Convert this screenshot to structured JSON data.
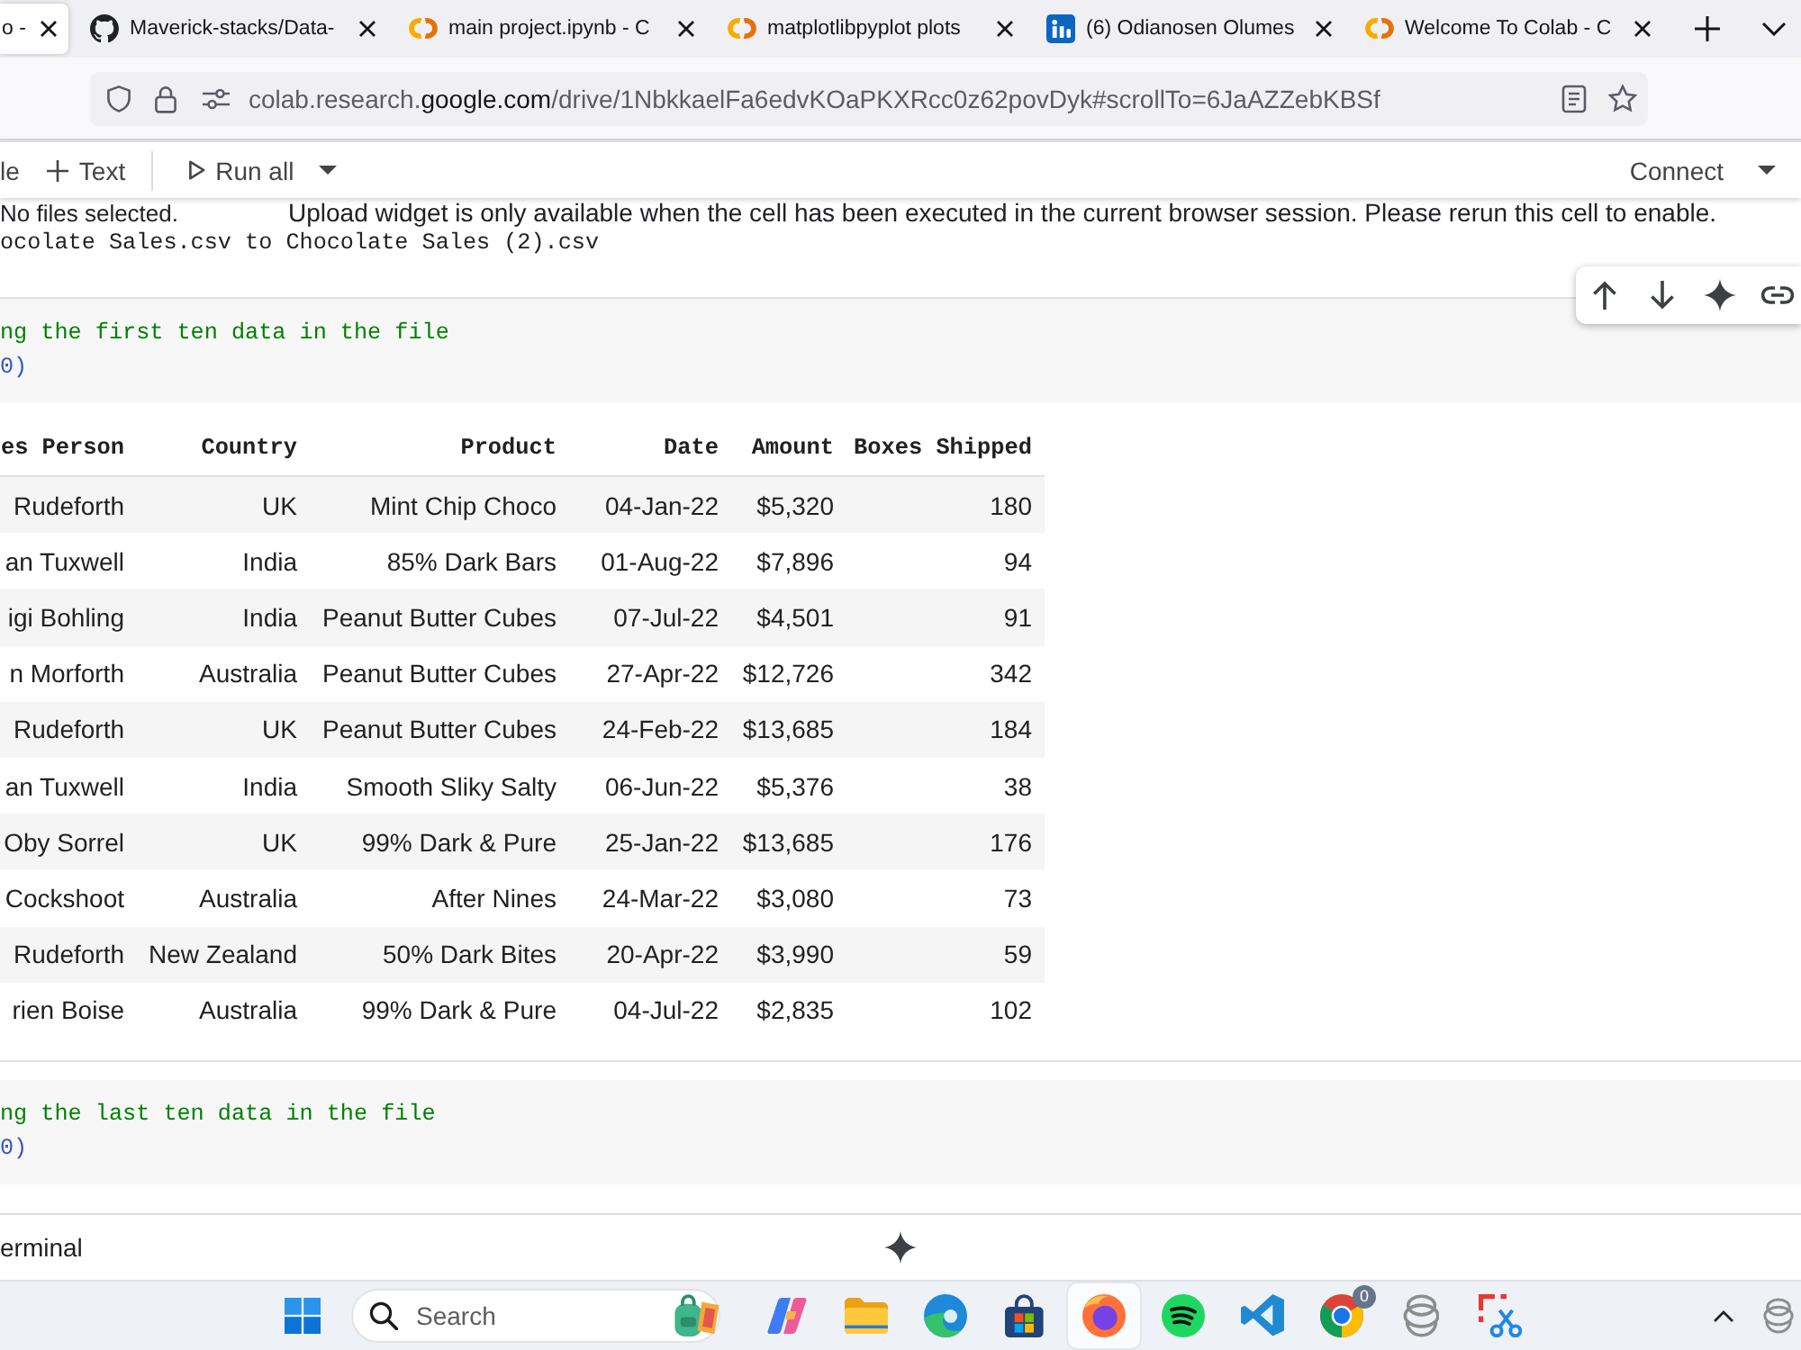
{
  "browser": {
    "tabs": [
      {
        "title": "o -",
        "kind": "none",
        "selected": true
      },
      {
        "title": "Maverick-stacks/Data-",
        "kind": "cat",
        "selected": false
      },
      {
        "title": "main project.ipynb - C",
        "kind": "rings",
        "selected": false
      },
      {
        "title": "matplotlibpyplot plots",
        "kind": "rings",
        "selected": false
      },
      {
        "title": "(6) Odianosen Olumes",
        "kind": "tile",
        "selected": false
      },
      {
        "title": "Welcome To Colab - C",
        "kind": "rings",
        "selected": false
      }
    ],
    "url": {
      "subdomain": "colab.research.",
      "domain": "google.com",
      "path": "/drive/1NbkkaelFa6edvKOaPKXRcc0z62povDyk#scrollTo=6JaAZZebKBSf"
    }
  },
  "notebook_toolbar": {
    "insert_buttons": [
      {
        "label": "le",
        "plus": false
      },
      {
        "label": "Text",
        "plus": true
      }
    ],
    "run_button": "Run all",
    "connect_button": "Connect"
  },
  "upload_output": {
    "status": "No files selected.",
    "notice": "Upload widget is only available when the cell has been executed in the current browser session. Please rerun this cell to enable.",
    "message": "ocolate Sales.csv to Chocolate Sales (2).csv"
  },
  "cells": [
    {
      "lines": [
        {
          "kind": "comment",
          "text": "ng the first ten data in the file"
        },
        {
          "kind": "call",
          "text": "0)"
        }
      ],
      "table": {
        "columns": [
          "es Person",
          "Country",
          "Product",
          "Date",
          "Amount",
          "Boxes Shipped"
        ],
        "rows": [
          [
            "Rudeforth",
            "UK",
            "Mint Chip Choco",
            "04-Jan-22",
            "$5,320",
            "180"
          ],
          [
            "an Tuxwell",
            "India",
            "85% Dark Bars",
            "01-Aug-22",
            "$7,896",
            "94"
          ],
          [
            "igi Bohling",
            "India",
            "Peanut Butter Cubes",
            "07-Jul-22",
            "$4,501",
            "91"
          ],
          [
            "n Morforth",
            "Australia",
            "Peanut Butter Cubes",
            "27-Apr-22",
            "$12,726",
            "342"
          ],
          [
            "Rudeforth",
            "UK",
            "Peanut Butter Cubes",
            "24-Feb-22",
            "$13,685",
            "184"
          ],
          [
            "an Tuxwell",
            "India",
            "Smooth Sliky Salty",
            "06-Jun-22",
            "$5,376",
            "38"
          ],
          [
            "Oby Sorrel",
            "UK",
            "99% Dark & Pure",
            "25-Jan-22",
            "$13,685",
            "176"
          ],
          [
            "Cockshoot",
            "Australia",
            "After Nines",
            "24-Mar-22",
            "$3,080",
            "73"
          ],
          [
            "Rudeforth",
            "New Zealand",
            "50% Dark Bites",
            "20-Apr-22",
            "$3,990",
            "59"
          ],
          [
            "rien Boise",
            "Australia",
            "99% Dark & Pure",
            "04-Jul-22",
            "$2,835",
            "102"
          ]
        ]
      }
    },
    {
      "lines": [
        {
          "kind": "comment",
          "text": "ng the last ten data in the file"
        },
        {
          "kind": "call",
          "text": "0)"
        }
      ]
    }
  ],
  "bottom_panel": {
    "tab": "erminal"
  },
  "taskbar": {
    "search": {
      "placeholder": "Search"
    },
    "apps": [
      {
        "kind": "swirl",
        "active": false
      },
      {
        "kind": "folder",
        "active": false
      },
      {
        "kind": "wave",
        "active": false
      },
      {
        "kind": "bag",
        "active": false
      },
      {
        "kind": "fox",
        "active": true
      },
      {
        "kind": "disc",
        "active": false
      },
      {
        "kind": "ribbon",
        "active": false
      },
      {
        "kind": "wheel",
        "active": false,
        "badge": "0"
      },
      {
        "kind": "rings",
        "active": false
      },
      {
        "kind": "scissors",
        "active": false
      }
    ]
  }
}
